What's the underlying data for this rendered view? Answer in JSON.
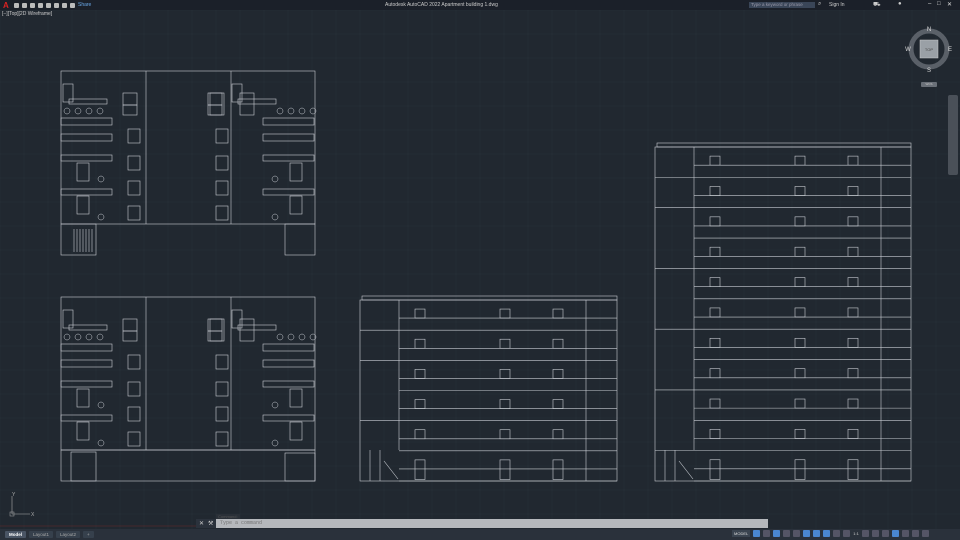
{
  "titlebar": {
    "app_title": "Autodesk AutoCAD 2022   Apartment building 1.dwg",
    "share_label": "Share",
    "search_placeholder": "Type a keyword or phrase",
    "sign_in": "Sign In"
  },
  "viewport": {
    "label": "[−][Top][2D Wireframe]"
  },
  "viewcube": {
    "face": "TOP",
    "north": "N",
    "south": "S",
    "east": "E",
    "west": "W",
    "wcs": "WCS"
  },
  "ucs": {
    "x": "X",
    "y": "Y"
  },
  "command": {
    "history": "Command:",
    "placeholder": "Type a command"
  },
  "tabs": [
    {
      "label": "Model",
      "active": true
    },
    {
      "label": "Layout1"
    },
    {
      "label": "Layout2"
    },
    {
      "label": "+"
    }
  ],
  "status": {
    "model_label": "MODEL",
    "scale": "1:1"
  },
  "colors": {
    "background": "#212830",
    "linework": "#c8ccd2",
    "accent": "#4a86d0"
  },
  "drawing": {
    "elevation_1_floors": 6,
    "elevation_2_floors": 11
  }
}
